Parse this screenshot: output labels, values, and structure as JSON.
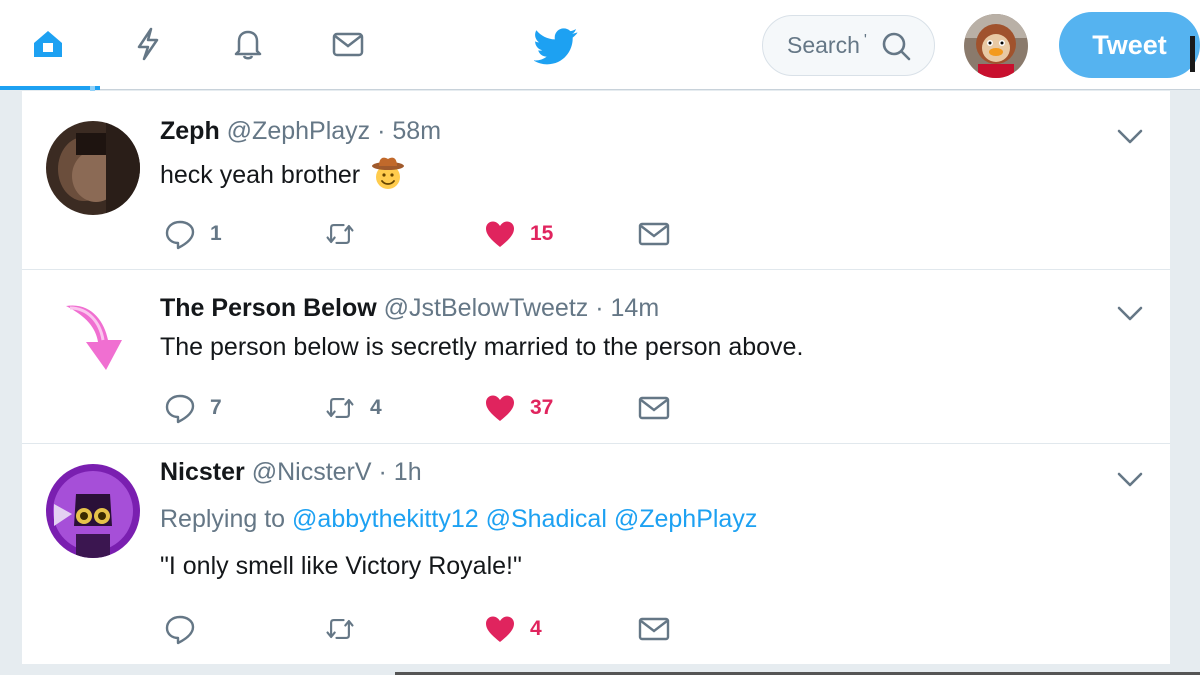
{
  "nav": {
    "items": [
      {
        "name": "home",
        "icon": "home-icon",
        "active": true
      },
      {
        "name": "moments",
        "icon": "lightning-icon",
        "active": false
      },
      {
        "name": "notifications",
        "icon": "bell-icon",
        "active": false
      },
      {
        "name": "messages",
        "icon": "envelope-icon",
        "active": false
      }
    ],
    "brand_icon": "twitter-bird-icon",
    "search_placeholder": "Search",
    "search_caret": "'",
    "tweet_button": "Tweet",
    "accent": "#1da1f2"
  },
  "timeline": [
    {
      "name": "Zeph",
      "handle": "@ZephPlayz",
      "dot": "·",
      "time": "58m",
      "text": "heck yeah brother",
      "emoji": "cowboy-face-emoji",
      "replies": "1",
      "retweets": "",
      "likes": "15",
      "liked": true
    },
    {
      "name": "The Person Below",
      "handle": "@JstBelowTweetz",
      "dot": "·",
      "time": "14m",
      "text": "The person below is secretly married to the person above.",
      "replies": "7",
      "retweets": "4",
      "likes": "37",
      "liked": true
    },
    {
      "name": "Nicster",
      "handle": "@NicsterV",
      "dot": "·",
      "time": "1h",
      "replying_prefix": "Replying to",
      "mentions": [
        "@abbythekitty12",
        "@Shadical",
        "@ZephPlayz"
      ],
      "text": "\"I only smell like Victory Royale!\"",
      "replies": "",
      "retweets": "",
      "likes": "4",
      "liked": true
    }
  ],
  "colors": {
    "like": "#e0245e",
    "muted": "#657786",
    "tweet_button": "#55b3f0"
  }
}
